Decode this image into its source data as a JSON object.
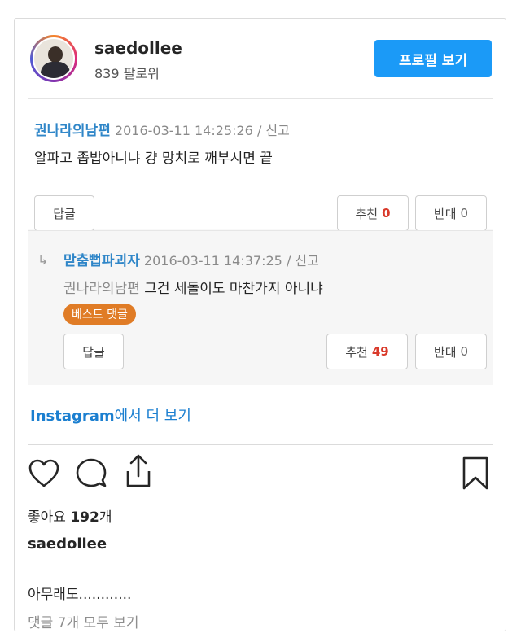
{
  "header": {
    "username": "saedollee",
    "followers": "839 팔로워",
    "profile_button": "프로필 보기"
  },
  "embedded_screenshot": {
    "comment1": {
      "author": "권나라의남편",
      "meta": " 2016-03-11 14:25:26 / 신고",
      "text": "알파고 좁밥아니냐 걍 망치로 깨부시면 끝",
      "reply_button": "답글",
      "recommend_label": "추천",
      "recommend_count": "0",
      "oppose_label": "반대",
      "oppose_count": "0"
    },
    "comment2": {
      "arrow": "↳",
      "author": "맏춤뻡파괴자",
      "meta": " 2016-03-11 14:37:25 / 신고",
      "reply_to": "권나라의남편",
      "text": " 그건 세돌이도 마찬가지 아니냐",
      "badge": "베스트 댓글",
      "reply_button": "답글",
      "recommend_label": "추천",
      "recommend_count": "49",
      "oppose_label": "반대",
      "oppose_count": "0"
    }
  },
  "more_link": {
    "brand": "Instagram",
    "rest": "에서 더 보기"
  },
  "actions": {
    "icons": [
      "heart-icon",
      "comment-icon",
      "share-icon",
      "bookmark-icon"
    ]
  },
  "likes": {
    "label": "좋아요 ",
    "count": "192",
    "suffix": "개"
  },
  "caption": {
    "username": "saedollee",
    "text": "아무래도............",
    "view_all": "댓글 7개 모두 보기"
  },
  "colors": {
    "accent": "#1b9af7",
    "link": "#1b7fd0",
    "author": "#2f86c8",
    "recommend": "#d93a2b",
    "best_badge": "#e07c26"
  }
}
